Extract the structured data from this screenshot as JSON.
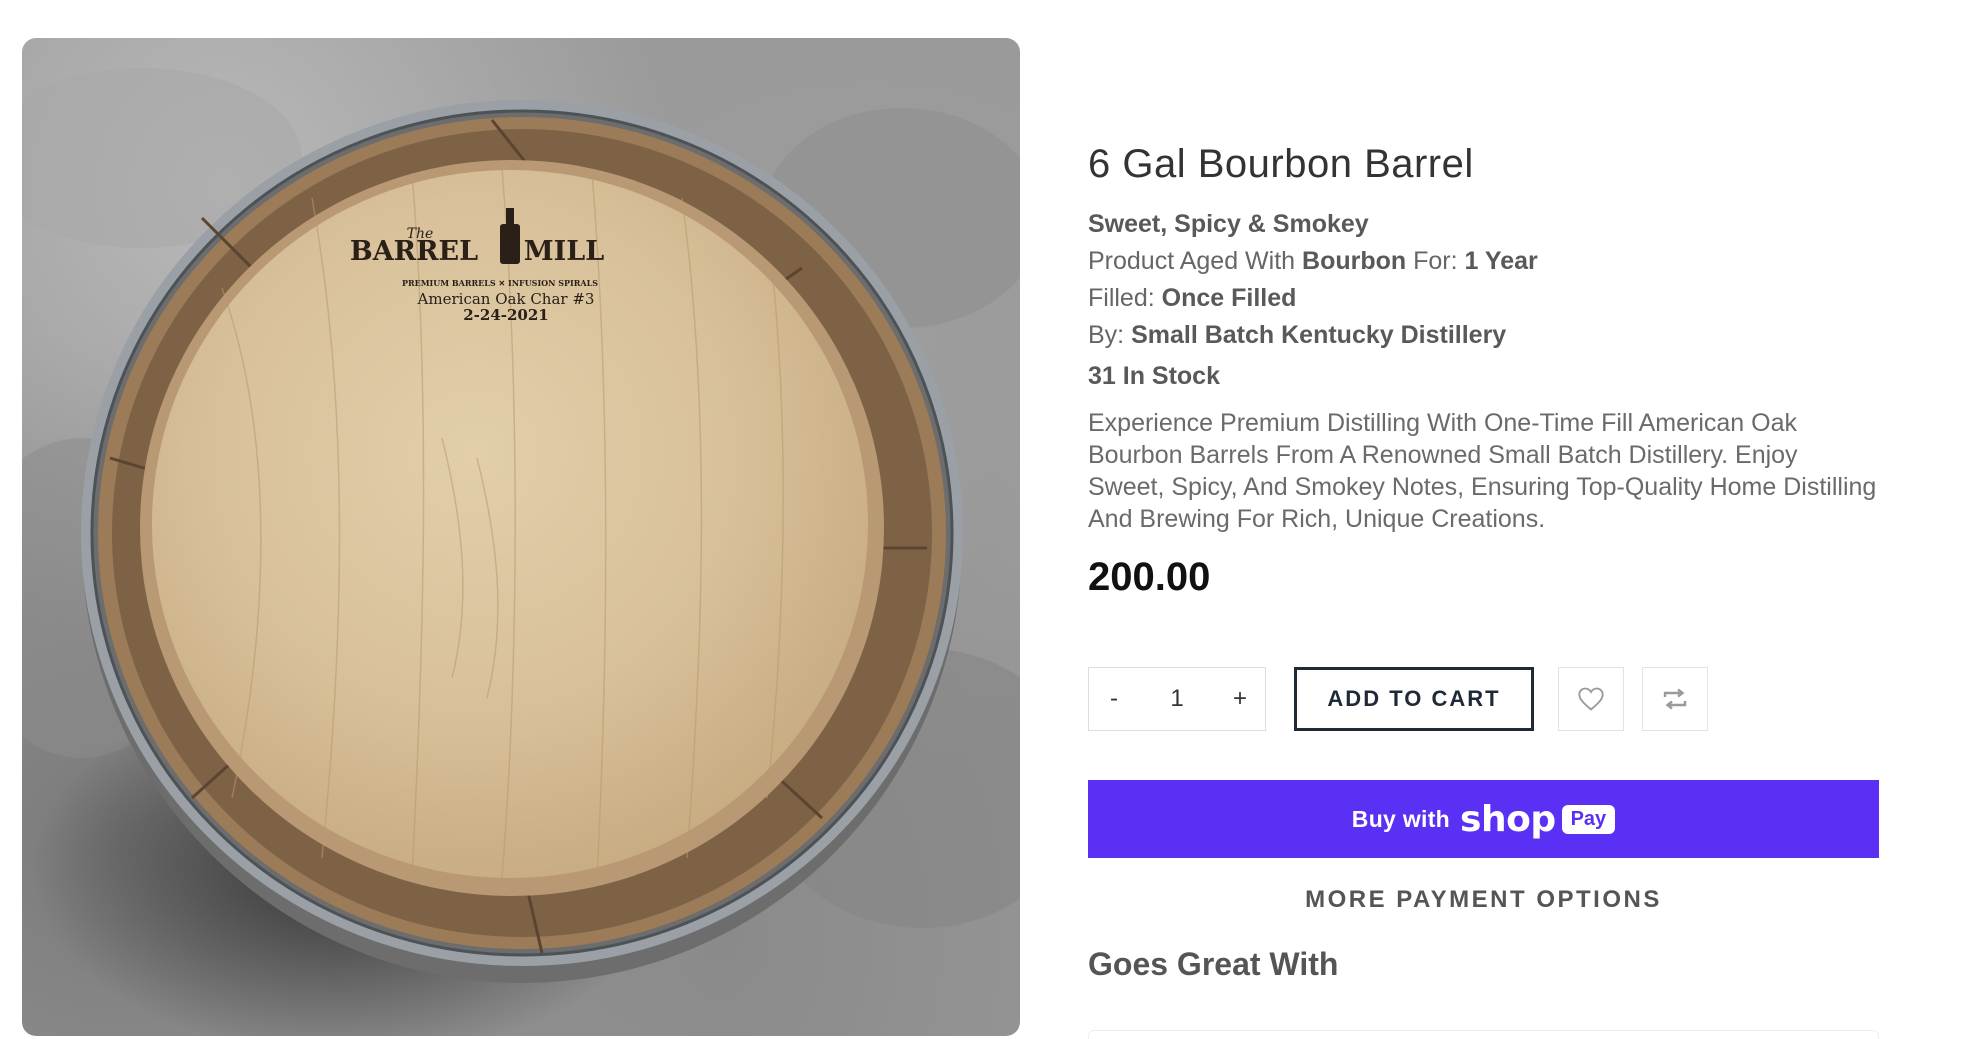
{
  "product": {
    "title": "6 Gal Bourbon Barrel",
    "flavor": "Sweet, Spicy & Smokey",
    "aged_prefix": "Product Aged With ",
    "aged_spirit": "Bourbon",
    "aged_mid": " For: ",
    "aged_duration": "1 Year",
    "filled_prefix": "Filled: ",
    "filled_value": "Once Filled",
    "by_prefix": "By: ",
    "by_value": "Small Batch Kentucky Distillery",
    "stock": "31 In Stock",
    "description": "Experience Premium Distilling With One-Time Fill American Oak Bourbon Barrels From A Renowned Small Batch Distillery. Enjoy Sweet, Spicy, And Smokey Notes, Ensuring Top-Quality Home Distilling And Brewing For Rich, Unique Creations.",
    "price": "200.00"
  },
  "image": {
    "stamp_brand_the": "The",
    "stamp_brand_left": "BARREL",
    "stamp_brand_right": "MILL",
    "stamp_tagline": "PREMIUM BARRELS ✕ INFUSION SPIRALS",
    "stamp_wood": "American Oak Char #3",
    "stamp_date": "2-24-2021"
  },
  "purchase": {
    "qty_minus": "-",
    "qty_value": "1",
    "qty_plus": "+",
    "add_to_cart": "ADD TO CART",
    "wishlist_icon": "heart-icon",
    "compare_icon": "compare-arrows-icon"
  },
  "shop_pay": {
    "buy_with": "Buy with",
    "shop": "shop",
    "pay": "Pay"
  },
  "more_payment": "MORE PAYMENT OPTIONS",
  "related": {
    "heading": "Goes Great With"
  },
  "colors": {
    "shop_pay_purple": "#5a31f4",
    "button_border": "#1f2937",
    "price_text": "#111111"
  }
}
